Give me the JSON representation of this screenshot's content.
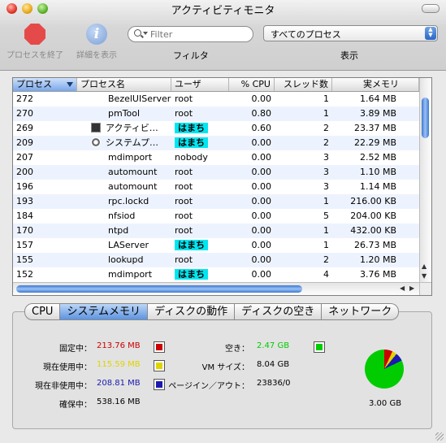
{
  "window": {
    "title": "アクティビティモニタ"
  },
  "toolbar": {
    "quit_label": "プロセスを終了",
    "inspect_label": "詳細を表示",
    "filter_placeholder": "Filter",
    "filter_label": "フィルタ",
    "show_value": "すべてのプロセス",
    "show_label": "表示"
  },
  "table": {
    "columns": [
      "プロセス",
      "プロセス名",
      "ユーザ",
      "% CPU",
      "スレッド数",
      "実メモリ"
    ],
    "rows": [
      {
        "pid": "272",
        "name": "BezelUIServer",
        "user": "root",
        "cpu": "0.00",
        "threads": "1",
        "mem": "1.64 MB"
      },
      {
        "pid": "270",
        "name": "pmTool",
        "user": "root",
        "cpu": "0.80",
        "threads": "1",
        "mem": "3.89 MB"
      },
      {
        "pid": "269",
        "name": "アクティビ…",
        "user": "はまち",
        "cpu": "0.60",
        "threads": "2",
        "mem": "23.37 MB",
        "icon": "terminal-icon"
      },
      {
        "pid": "209",
        "name": "システムプ…",
        "user": "はまち",
        "cpu": "0.00",
        "threads": "2",
        "mem": "22.29 MB",
        "icon": "system-prefs-icon"
      },
      {
        "pid": "207",
        "name": "mdimport",
        "user": "nobody",
        "cpu": "0.00",
        "threads": "3",
        "mem": "2.52 MB"
      },
      {
        "pid": "200",
        "name": "automount",
        "user": "root",
        "cpu": "0.00",
        "threads": "3",
        "mem": "1.10 MB"
      },
      {
        "pid": "196",
        "name": "automount",
        "user": "root",
        "cpu": "0.00",
        "threads": "3",
        "mem": "1.14 MB"
      },
      {
        "pid": "193",
        "name": "rpc.lockd",
        "user": "root",
        "cpu": "0.00",
        "threads": "1",
        "mem": "216.00 KB"
      },
      {
        "pid": "184",
        "name": "nfsiod",
        "user": "root",
        "cpu": "0.00",
        "threads": "5",
        "mem": "204.00 KB"
      },
      {
        "pid": "170",
        "name": "ntpd",
        "user": "root",
        "cpu": "0.00",
        "threads": "1",
        "mem": "432.00 KB"
      },
      {
        "pid": "157",
        "name": "LAServer",
        "user": "はまち",
        "cpu": "0.00",
        "threads": "1",
        "mem": "26.73 MB"
      },
      {
        "pid": "155",
        "name": "lookupd",
        "user": "root",
        "cpu": "0.00",
        "threads": "2",
        "mem": "1.20 MB"
      },
      {
        "pid": "152",
        "name": "mdimport",
        "user": "はまち",
        "cpu": "0.00",
        "threads": "4",
        "mem": "3.76 MB"
      }
    ],
    "highlight_user": "はまち",
    "highlight_color": "#00e6f0"
  },
  "tabs": [
    "CPU",
    "システムメモリ",
    "ディスクの動作",
    "ディスクの空き",
    "ネットワーク"
  ],
  "active_tab": "システムメモリ",
  "memory": {
    "wired_label": "固定中：",
    "wired_value": "213.76 MB",
    "wired_color": "#cc0000",
    "active_label": "現在使用中：",
    "active_value": "115.59 MB",
    "active_color": "#e0d400",
    "inactive_label": "現在非使用中：",
    "inactive_value": "208.81 MB",
    "inactive_color": "#1a1ab0",
    "used_label": "確保中：",
    "used_value": "538.16 MB",
    "free_label": "空き：",
    "free_value": "2.47 GB",
    "free_color": "#00cc00",
    "vm_label": "VM サイズ：",
    "vm_value": "8.04 GB",
    "pageins_label": "ページイン／アウト：",
    "pageins_value": "23836/0",
    "total": "3.00 GB"
  }
}
